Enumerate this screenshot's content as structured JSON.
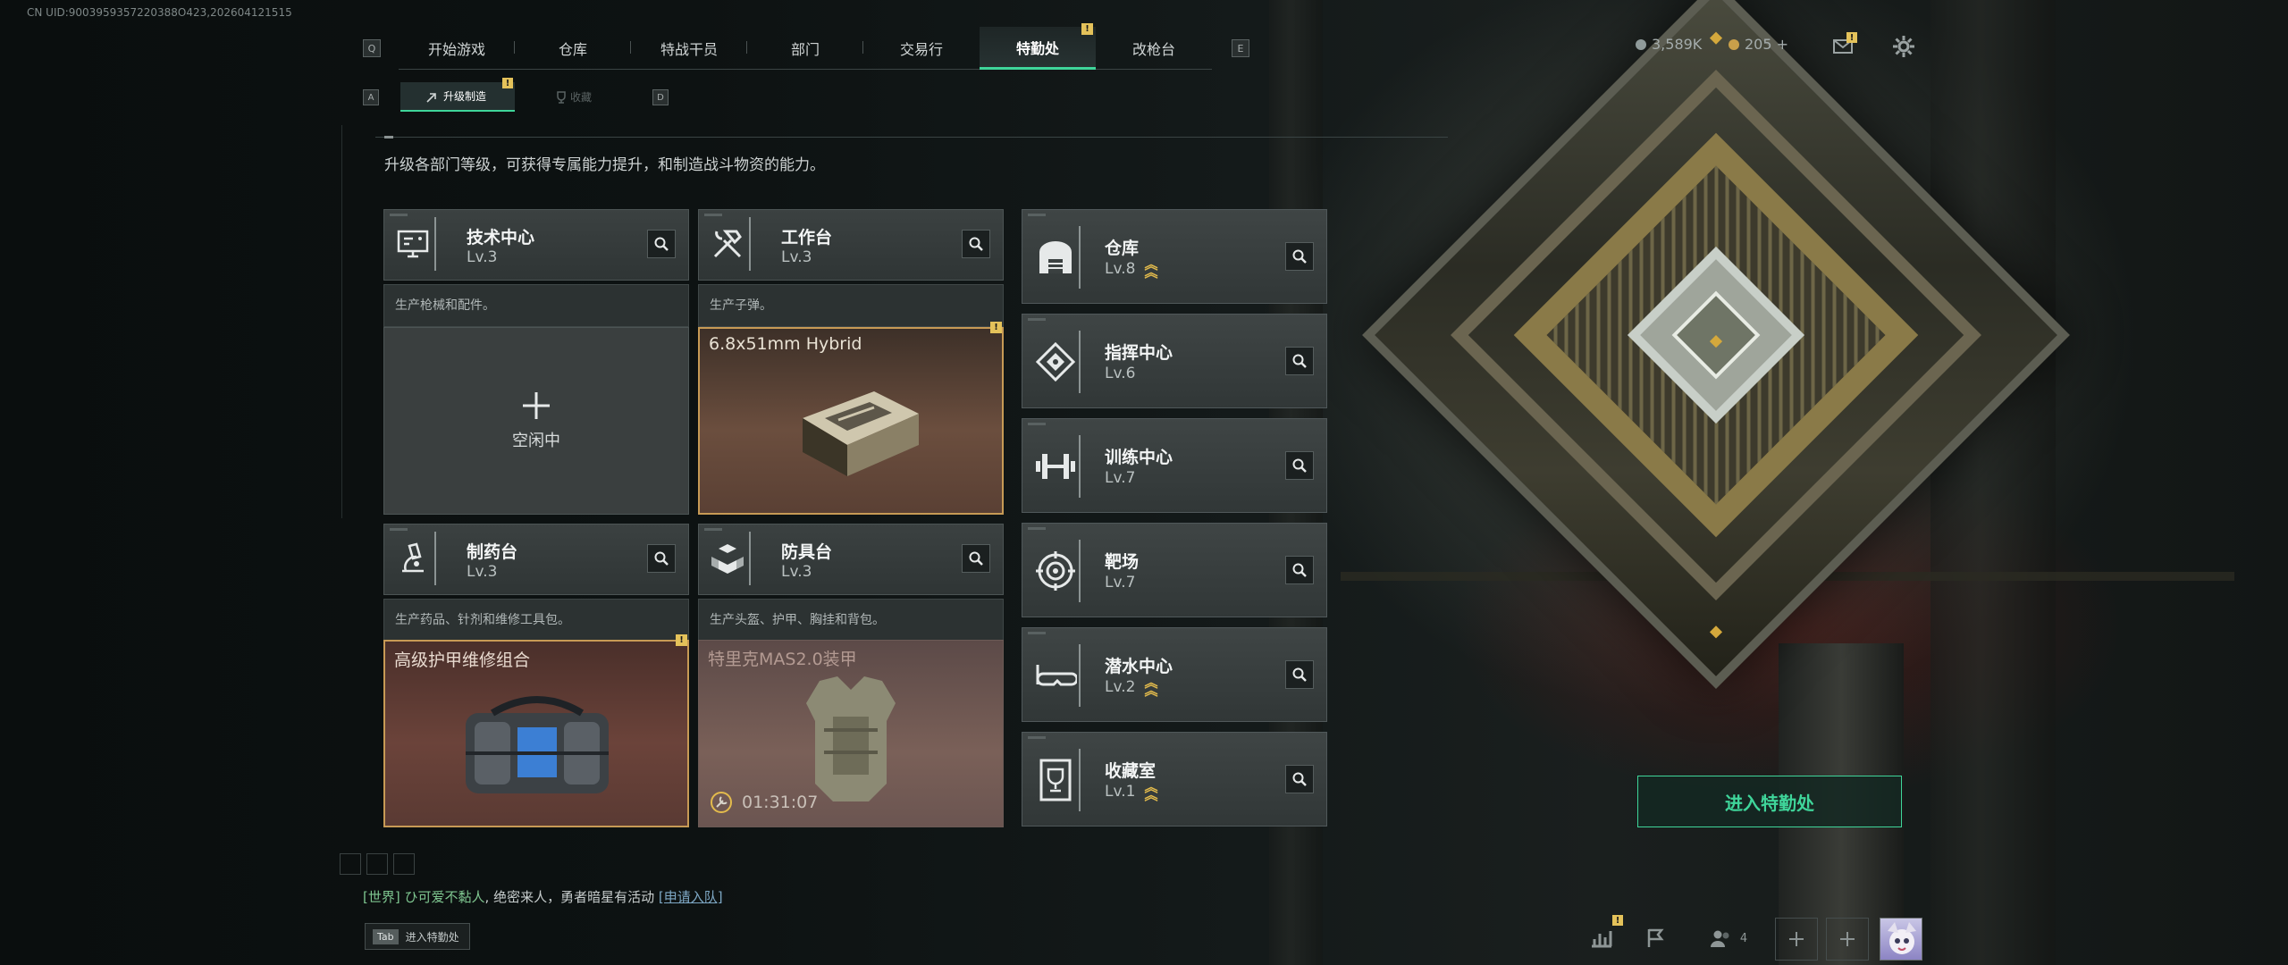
{
  "uid_text": "CN UID:9003959357220388O423,202604121515",
  "nav": {
    "left_key": "Q",
    "right_key": "E",
    "tabs": [
      "开始游戏",
      "仓库",
      "特战干员",
      "部门",
      "交易行",
      "特勤处",
      "改枪台"
    ],
    "active_tab": "特勤处",
    "badge": "!"
  },
  "subnav": {
    "left_key": "A",
    "right_key": "D",
    "tabs": [
      "升级制造",
      "收藏"
    ],
    "badge": "!"
  },
  "currency": {
    "coins": "3,589K",
    "tokens": "205 +",
    "mail_badge": "!"
  },
  "description": "升级各部门等级，可获得专属能力提升，和制造战斗物资的能力。",
  "left_departments": [
    {
      "name": "技术中心",
      "level": "Lv.3",
      "icon": "pc-icon",
      "subtitle": "生产枪械和配件。",
      "slot": {
        "state": "idle",
        "label": "空闲中"
      }
    },
    {
      "name": "工作台",
      "level": "Lv.3",
      "icon": "hammer-wrench-icon",
      "subtitle": "生产子弹。",
      "slot": {
        "state": "ready",
        "title": "6.8x51mm Hybrid",
        "badge": "!"
      }
    },
    {
      "name": "制药台",
      "level": "Lv.3",
      "icon": "microscope-icon",
      "subtitle": "生产药品、针剂和维修工具包。",
      "slot": {
        "state": "ready",
        "title": "高级护甲维修组合",
        "badge": "!"
      }
    },
    {
      "name": "防具台",
      "level": "Lv.3",
      "icon": "cubes-icon",
      "subtitle": "生产头盔、护甲、胸挂和背包。",
      "slot": {
        "state": "producing",
        "title": "特里克MAS2.0装甲",
        "timer": "01:31:07"
      }
    }
  ],
  "right_departments": [
    {
      "name": "仓库",
      "level": "Lv.8",
      "icon": "warehouse-icon",
      "upgrade": true
    },
    {
      "name": "指挥中心",
      "level": "Lv.6",
      "icon": "command-icon",
      "upgrade": false
    },
    {
      "name": "训练中心",
      "level": "Lv.7",
      "icon": "dumbbell-icon",
      "upgrade": false
    },
    {
      "name": "靶场",
      "level": "Lv.7",
      "icon": "target-icon",
      "upgrade": false
    },
    {
      "name": "潜水中心",
      "level": "Lv.2",
      "icon": "diving-mask-icon",
      "upgrade": true
    },
    {
      "name": "收藏室",
      "level": "Lv.1",
      "icon": "trophy-icon",
      "upgrade": true
    }
  ],
  "enter_button": "进入特勤处",
  "chat": {
    "channel": "[世界]",
    "user": "ひ可爱不黏人",
    "message": "绝密来人，勇者暗星有活动",
    "link": "[申请入队]"
  },
  "tab_hint": {
    "key": "Tab",
    "label": "进入特勤处"
  },
  "bottom": {
    "stats_badge": "!",
    "friends_count": "4"
  },
  "colors": {
    "accent": "#3fd59a",
    "gold": "#e3bb4c",
    "badge": "#e4c25a"
  }
}
